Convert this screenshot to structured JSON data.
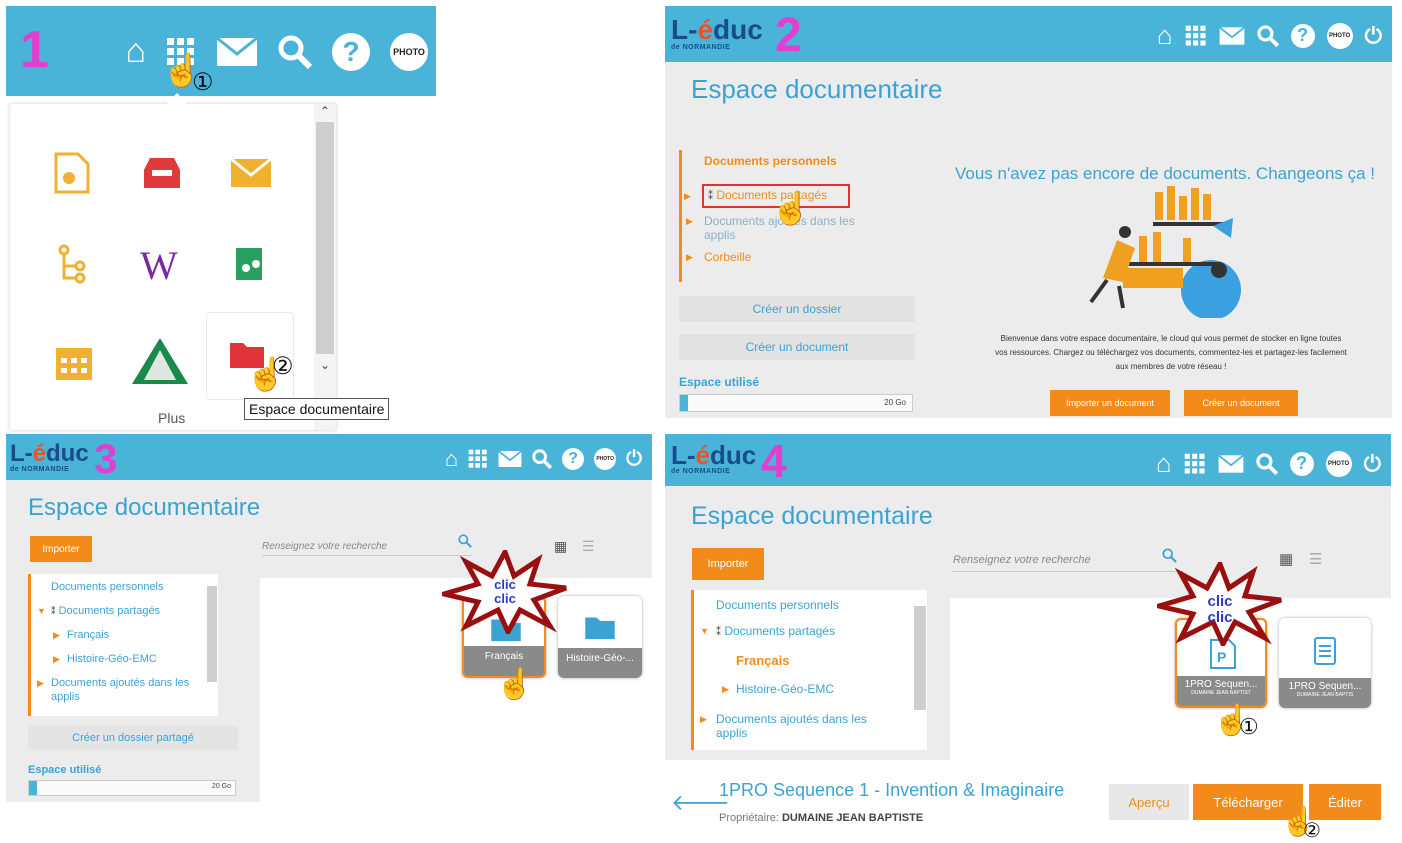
{
  "colors": {
    "header": "#4ab3d8",
    "accent": "#f28b1a",
    "title": "#3aa3d4",
    "step": "#e040d0",
    "burst": "#9a1010"
  },
  "step_labels": [
    "1",
    "2",
    "3",
    "4"
  ],
  "circled": {
    "one": "①",
    "two": "②"
  },
  "header_icons": [
    "home-icon",
    "apps-grid-icon",
    "mail-icon",
    "search-icon",
    "help-icon",
    "photo-avatar",
    "power-icon"
  ],
  "photo_label": "PHOTO",
  "logo": {
    "l": "L-",
    "e": "é",
    "rest": "duc",
    "sub": "de NORMANDIE"
  },
  "panel1": {
    "more_label": "Plus",
    "tooltip": "Espace documentaire"
  },
  "panel2": {
    "title": "Espace documentaire",
    "tree": [
      "Documents personnels",
      "Documents partagés",
      "Documents ajoutés dans les applis",
      "Corbeille"
    ],
    "btn_create_folder": "Créer un dossier",
    "btn_create_doc": "Créer un document",
    "space_label": "Espace utilisé",
    "space_value": "20 Go",
    "empty_title": "Vous n'avez pas encore de documents. Changeons ça !",
    "empty_text": "Bienvenue dans votre espace documentaire, le cloud qui vous permet de stocker en ligne toutes vos ressources. Chargez ou téléchargez vos documents, commentez-les et partagez-les facilement aux membres de votre réseau !",
    "btn_import": "Importer un document",
    "btn_create": "Créer un document"
  },
  "panel3": {
    "title": "Espace documentaire",
    "btn_import": "Importer",
    "search_placeholder": "Renseignez votre recherche",
    "tree": [
      "Documents personnels",
      "Documents partagés",
      "Français",
      "Histoire-Géo-EMC",
      "Documents ajoutés dans les applis"
    ],
    "btn_create_shared": "Créer un dossier partagé",
    "space_label": "Espace utilisé",
    "space_value": "20 Go",
    "folders": [
      "Français",
      "Histoire-Géo-..."
    ],
    "burst_text": [
      "clic",
      "clic"
    ]
  },
  "panel4": {
    "title": "Espace documentaire",
    "btn_import": "Importer",
    "search_placeholder": "Renseignez votre recherche",
    "tree": [
      "Documents personnels",
      "Documents partagés",
      "Français",
      "Histoire-Géo-EMC",
      "Documents ajoutés dans les applis"
    ],
    "files": [
      {
        "name": "1PRO Sequen...",
        "owner": "DUMAINE JEAN BAPTIST"
      },
      {
        "name": "1PRO Sequen...",
        "owner": "DUMAINE JEAN BAPTIS"
      }
    ],
    "burst_text": [
      "clic",
      "clic"
    ],
    "doc_title": "1PRO Sequence 1 - Invention & Imaginaire",
    "owner_label": "Propriétaire:",
    "owner_name": "DUMAINE JEAN BAPTISTE",
    "btn_preview": "Aperçu",
    "btn_download": "Télécharger",
    "btn_edit": "Éditer"
  }
}
